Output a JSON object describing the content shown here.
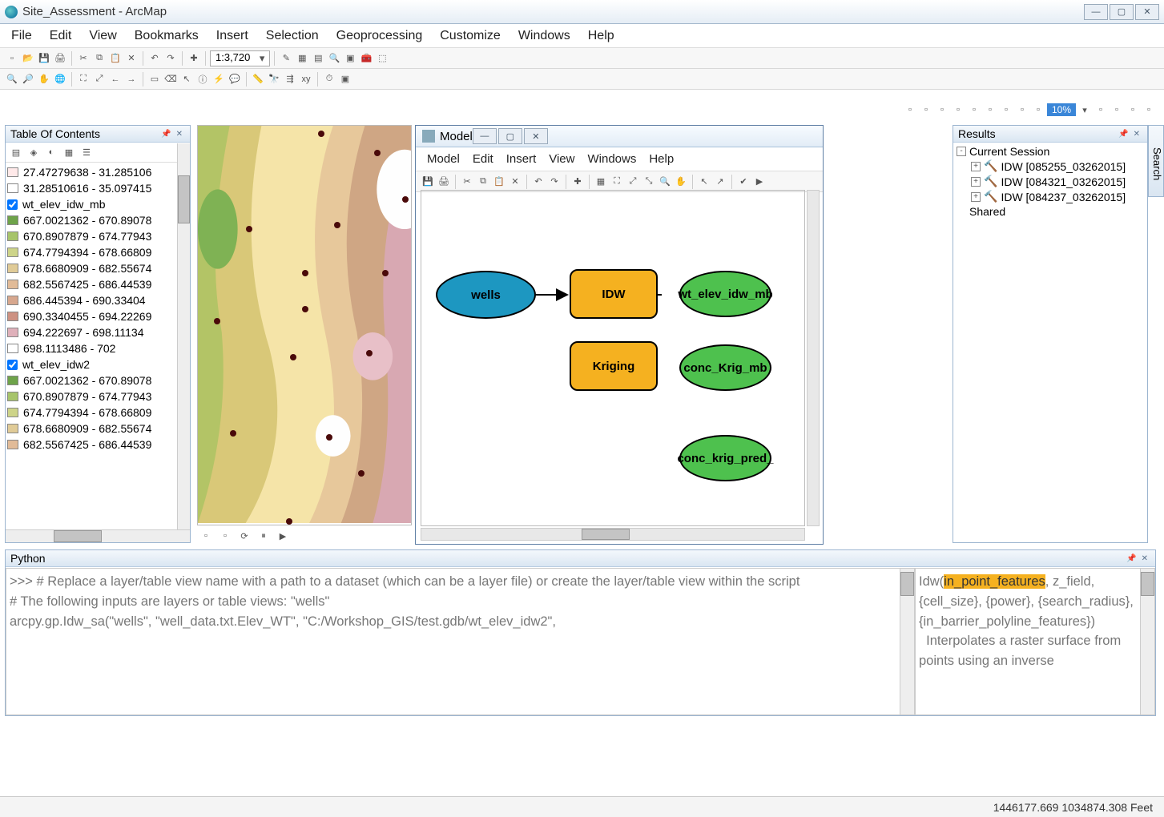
{
  "app": {
    "title": "Site_Assessment - ArcMap"
  },
  "menubar": [
    "File",
    "Edit",
    "View",
    "Bookmarks",
    "Insert",
    "Selection",
    "Geoprocessing",
    "Customize",
    "Windows",
    "Help"
  ],
  "scale": "1:3,720",
  "toc": {
    "title": "Table Of Contents",
    "layers": [
      {
        "chk": false,
        "swatch": "#ffe9e9",
        "label": "27.47279638 - 31.285106"
      },
      {
        "chk": false,
        "swatch": "#ffffff",
        "label": "31.28510616 - 35.097415"
      }
    ],
    "group1_name": "wt_elev_idw_mb",
    "group1": [
      {
        "swatch": "#6ea34a",
        "label": "667.0021362 - 670.89078"
      },
      {
        "swatch": "#a7c46b",
        "label": "670.8907879 - 674.77943"
      },
      {
        "swatch": "#cdd489",
        "label": "674.7794394 - 678.66809"
      },
      {
        "swatch": "#e0cb97",
        "label": "678.6680909 - 682.55674"
      },
      {
        "swatch": "#e1bb98",
        "label": "682.5567425 - 686.44539"
      },
      {
        "swatch": "#d7a78e",
        "label": "686.445394 - 690.33404"
      },
      {
        "swatch": "#cd9182",
        "label": "690.3340455 - 694.22269"
      },
      {
        "swatch": "#dfb0ba",
        "label": "694.222697 - 698.11134"
      },
      {
        "swatch": "#ffffff",
        "label": "698.1113486 - 702"
      }
    ],
    "group2_name": "wt_elev_idw2",
    "group2": [
      {
        "swatch": "#6ea34a",
        "label": "667.0021362 - 670.89078"
      },
      {
        "swatch": "#a7c46b",
        "label": "670.8907879 - 674.77943"
      },
      {
        "swatch": "#cdd489",
        "label": "674.7794394 - 678.66809"
      },
      {
        "swatch": "#e0cb97",
        "label": "678.6680909 - 682.55674"
      },
      {
        "swatch": "#e1bb98",
        "label": "682.5567425 - 686.44539"
      }
    ]
  },
  "model": {
    "title": "Model",
    "menubar": [
      "Model",
      "Edit",
      "Insert",
      "View",
      "Windows",
      "Help"
    ],
    "nodes": {
      "wells": "wells",
      "idw": "IDW",
      "kriging": "Kriging",
      "out_idw": "wt_elev_idw_mb",
      "out_krig": "conc_Krig_mb",
      "out_pred": "conc_krig_pred_"
    }
  },
  "results": {
    "title": "Results",
    "session": "Current Session",
    "items": [
      "IDW [085255_03262015]",
      "IDW [084321_03262015]",
      "IDW [084237_03262015]"
    ],
    "shared": "Shared"
  },
  "python": {
    "title": "Python",
    "left": ">>> # Replace a layer/table view name with a path to a dataset (which can be a layer file) or create the layer/table view within the script\n# The following inputs are layers or table views: \"wells\"\narcpy.gp.Idw_sa(\"wells\", \"well_data.txt.Elev_WT\", \"C:/Workshop_GIS/test.gdb/wt_elev_idw2\",",
    "right_pre": "Idw(",
    "right_hl": "in_point_features",
    "right_post": ", z_field, {cell_size}, {power}, {search_radius}, {in_barrier_polyline_features})\n  Interpolates a raster surface from points using an inverse"
  },
  "status": "1446177.669 1034874.308 Feet",
  "search_tab": "Search",
  "percent": "10%"
}
